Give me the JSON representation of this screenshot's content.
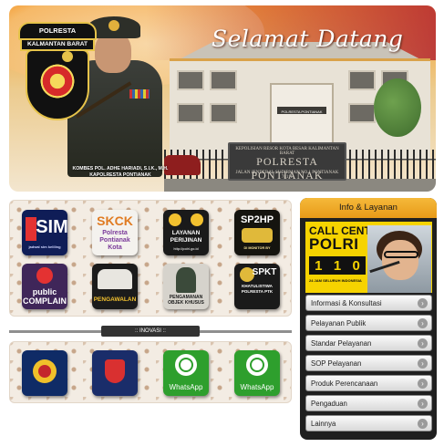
{
  "banner": {
    "welcome_text": "Selamat Datang",
    "logo_line1": "POLRESTA PONTIANAK",
    "logo_line2": "KALMANTAN BARAT",
    "officer_caption_line1": "KOMBES POL. ADHE HARIADI, S.I.K., M.H.",
    "officer_caption_line2": "KAPOLRESTA PONTIANAK",
    "building_sign": "POLRESTA PONTIANAK",
    "stone_line1": "KEPOLISIAN RESOR KOTA BESAR KALIMANTAN BARAT",
    "stone_line2": "POLRESTA PONTIANAK",
    "stone_line3": "JALAN JENDERAL SUDIRMAN NO.1 PONTIANAK 78111"
  },
  "tiles": [
    {
      "id": "sim",
      "title": "SIM",
      "subtitle": "jadwal sim keliling",
      "bg": "#0f1d57",
      "accent": "#e43232"
    },
    {
      "id": "skck",
      "title": "SKCK",
      "subtitle": "Polresta Pontianak Kota",
      "bg": "#f4f2ee",
      "accent": "#e07b22"
    },
    {
      "id": "perijinan",
      "title": "LAYANAN PERIJINAN",
      "subtitle": "http://polri.go.id",
      "bg": "#1a1a1a",
      "accent": "#f2c12f"
    },
    {
      "id": "sp2hp",
      "title": "SP2HP",
      "subtitle": "DI MONITOR BY",
      "bg": "#15140f",
      "accent": "#e0b93a"
    },
    {
      "id": "public",
      "title": "public COMPLAIN",
      "subtitle": "",
      "bg": "#3f2659",
      "accent": "#e43232"
    },
    {
      "id": "pengawalan",
      "title": "PENGAWALAN",
      "subtitle": "",
      "bg": "#1b1b1b",
      "accent": "#f2c12f"
    },
    {
      "id": "pengamanan",
      "title": "PENGAMANAN OBJEK KHUSUS",
      "subtitle": "",
      "bg": "#d6d3cc",
      "accent": "#1a1a1a"
    },
    {
      "id": "spkt",
      "title": "SPKT",
      "subtitle": "KHATULISTIWA POLRESTA PTK",
      "bg": "#1a1a1a",
      "accent": "#d63131"
    }
  ],
  "inovasi": {
    "label": ":: INOVASI ::",
    "items": [
      {
        "id": "inov-1",
        "text": "",
        "bg": "#0f2b66"
      },
      {
        "id": "inov-2",
        "text": "",
        "bg": "#1a2d6a"
      },
      {
        "id": "whatsapp-1",
        "text": "WhatsApp",
        "bg": "#2e9f2d"
      },
      {
        "id": "whatsapp-2",
        "text": "WhatsApp",
        "bg": "#2e9f2d"
      }
    ]
  },
  "sidebar": {
    "title": "Info & Layanan",
    "call_center": {
      "line1": "CALL CENTER",
      "line2": "POLRI",
      "digits": [
        "1",
        "1",
        "0"
      ],
      "line3": "24 JAM SELURUH INDONESIA"
    },
    "menu": [
      {
        "label": "Informasi & Konsultasi"
      },
      {
        "label": "Pelayanan Publik"
      },
      {
        "label": "Standar Pelayanan"
      },
      {
        "label": "SOP Pelayanan"
      },
      {
        "label": "Produk Perencanaan"
      },
      {
        "label": "Pengaduan"
      },
      {
        "label": "Lainnya"
      }
    ],
    "menu_icon": "chevron-right-icon"
  },
  "colors": {
    "header_orange": "#f0a339",
    "sidebar_bg": "#1f1f1f",
    "call_center_yellow": "#f6d300"
  }
}
